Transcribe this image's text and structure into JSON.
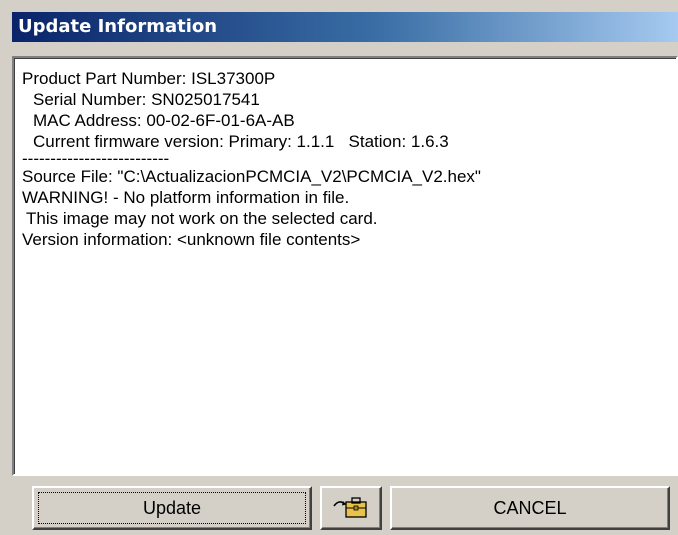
{
  "window": {
    "title": "Update Information"
  },
  "info": {
    "lines": [
      "Product Part Number: ISL37300P",
      "Serial Number: SN025017541",
      "MAC Address: 00-02-6F-01-6A-AB",
      "Current firmware version: Primary: 1.1.1   Station: 1.6.3",
      "--------------------------",
      "Source File: \"C:\\ActualizacionPCMCIA_V2\\PCMCIA_V2.hex\"",
      "WARNING! - No platform information in file.",
      "This image may not work on the selected card.",
      "Version information: <unknown file contents>"
    ]
  },
  "buttons": {
    "update_label": "Update",
    "cancel_label": "CANCEL",
    "icon": "folder-arrow-icon"
  }
}
